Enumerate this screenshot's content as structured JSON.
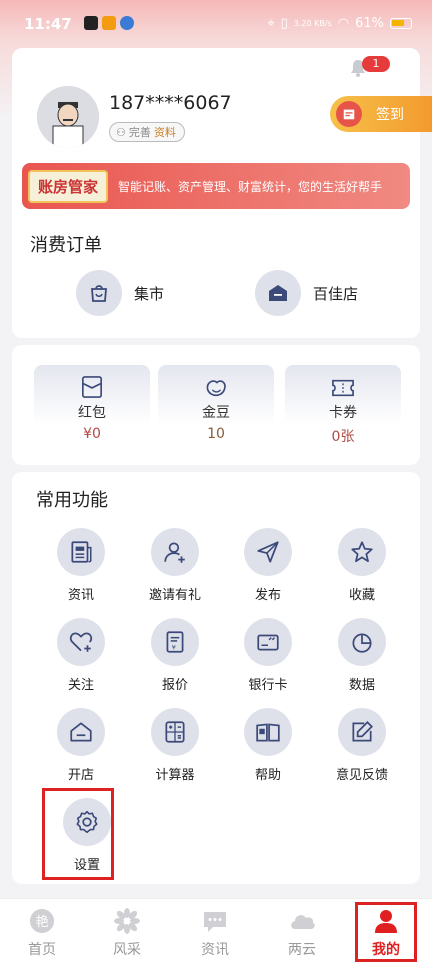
{
  "status_bar": {
    "time": "11:47",
    "network_speed": "3.20 KB/s",
    "battery": "61%"
  },
  "notifications": {
    "count": "1"
  },
  "profile": {
    "phone": "187****6067",
    "complete_prefix": "完善",
    "complete_highlight": "资料",
    "sign_in_label": "签到"
  },
  "ledger": {
    "title": "账房管家",
    "description": "智能记账、资产管理、财富统计，您的生活好帮手"
  },
  "orders": {
    "title": "消费订单",
    "items": [
      {
        "label": "集市",
        "icon": "shopping-bag-icon"
      },
      {
        "label": "百佳店",
        "icon": "store-icon"
      }
    ]
  },
  "wallet": {
    "items": [
      {
        "name": "红包",
        "value": "¥0",
        "icon": "red-envelope-icon"
      },
      {
        "name": "金豆",
        "value": "10",
        "icon": "bean-icon"
      },
      {
        "name": "卡券",
        "value": "0张",
        "icon": "coupon-icon"
      }
    ]
  },
  "functions": {
    "title": "常用功能",
    "items": [
      {
        "label": "资讯",
        "icon": "newspaper-icon"
      },
      {
        "label": "邀请有礼",
        "icon": "invite-user-icon"
      },
      {
        "label": "发布",
        "icon": "paper-plane-icon"
      },
      {
        "label": "收藏",
        "icon": "star-icon"
      },
      {
        "label": "关注",
        "icon": "heart-plus-icon"
      },
      {
        "label": "报价",
        "icon": "price-sheet-icon"
      },
      {
        "label": "银行卡",
        "icon": "bank-card-icon"
      },
      {
        "label": "数据",
        "icon": "pie-chart-icon"
      },
      {
        "label": "开店",
        "icon": "open-store-icon"
      },
      {
        "label": "计算器",
        "icon": "calculator-icon"
      },
      {
        "label": "帮助",
        "icon": "book-icon"
      },
      {
        "label": "意见反馈",
        "icon": "feedback-edit-icon"
      },
      {
        "label": "设置",
        "icon": "gear-icon"
      }
    ]
  },
  "tabbar": {
    "items": [
      {
        "label": "首页",
        "icon": "home-logo-icon",
        "active": false
      },
      {
        "label": "风采",
        "icon": "flower-icon",
        "active": false
      },
      {
        "label": "资讯",
        "icon": "chat-bubble-icon",
        "active": false
      },
      {
        "label": "两云",
        "icon": "cloud-icon",
        "active": false
      },
      {
        "label": "我的",
        "icon": "person-icon",
        "active": true
      }
    ]
  },
  "colors": {
    "accent_red": "#e02020",
    "icon_bg": "#dfe1ea",
    "icon_stroke": "#3c4a7a"
  }
}
